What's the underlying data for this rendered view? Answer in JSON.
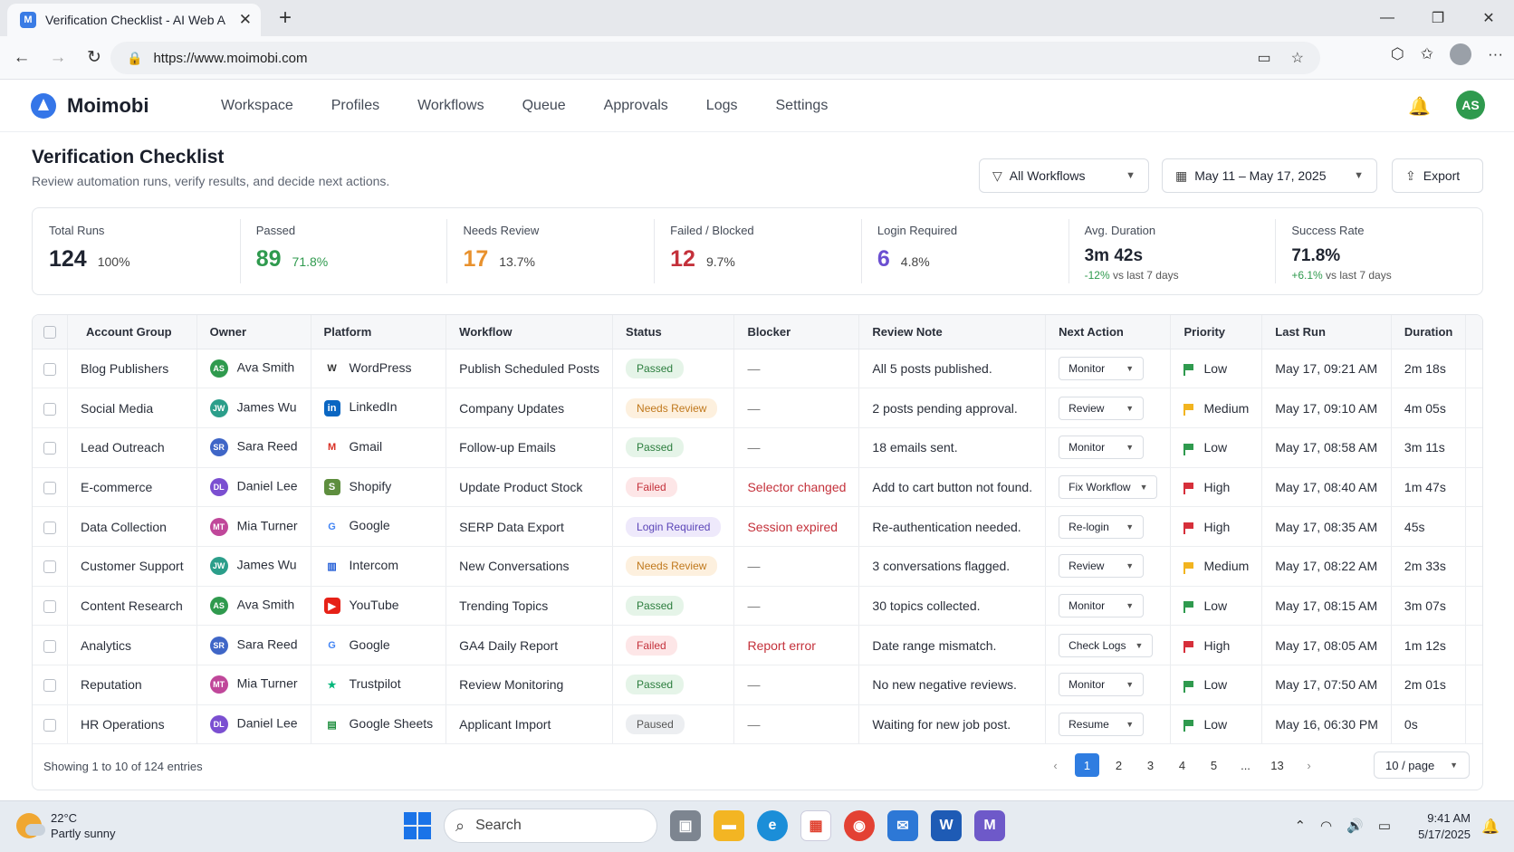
{
  "browser": {
    "tab_title": "Verification Checklist - AI Web A",
    "tab_favicon": "M",
    "url": "https://www.moimobi.com"
  },
  "app": {
    "name": "Moimobi",
    "nav": [
      "Workspace",
      "Profiles",
      "Workflows",
      "Queue",
      "Approvals",
      "Logs",
      "Settings"
    ],
    "user_initials": "AS"
  },
  "page": {
    "title": "Verification Checklist",
    "subtitle": "Review automation runs, verify results, and decide next actions.",
    "filter_workflow": "All Workflows",
    "date_range": "May 11 – May 17, 2025",
    "export_label": "Export"
  },
  "stats": {
    "total": {
      "label": "Total Runs",
      "value": "124",
      "pct": "100%"
    },
    "passed": {
      "label": "Passed",
      "value": "89",
      "pct": "71.8%"
    },
    "review": {
      "label": "Needs Review",
      "value": "17",
      "pct": "13.7%"
    },
    "failed": {
      "label": "Failed / Blocked",
      "value": "12",
      "pct": "9.7%"
    },
    "login": {
      "label": "Login Required",
      "value": "6",
      "pct": "4.8%"
    },
    "duration": {
      "label": "Avg. Duration",
      "value": "3m 42s",
      "trend": "-12%",
      "trend_text": "vs last 7 days"
    },
    "success": {
      "label": "Success Rate",
      "value": "71.8%",
      "trend": "+6.1%",
      "trend_text": "vs last 7 days"
    }
  },
  "table": {
    "columns": [
      "Account Group",
      "Owner",
      "Platform",
      "Workflow",
      "Status",
      "Blocker",
      "Review Note",
      "Next Action",
      "Priority",
      "Last Run",
      "Duration"
    ],
    "rows": [
      {
        "group": "Blog Publishers",
        "owner": "Ava Smith",
        "initials": "AS",
        "platform": "WordPress",
        "workflow": "Publish Scheduled Posts",
        "status": "Passed",
        "blocker": "—",
        "note": "All 5 posts published.",
        "action": "Monitor",
        "priority": "Low",
        "last_run": "May 17, 09:21 AM",
        "duration": "2m 18s"
      },
      {
        "group": "Social Media",
        "owner": "James Wu",
        "initials": "JW",
        "platform": "LinkedIn",
        "workflow": "Company Updates",
        "status": "Needs Review",
        "blocker": "—",
        "note": "2 posts pending approval.",
        "action": "Review",
        "priority": "Medium",
        "last_run": "May 17, 09:10 AM",
        "duration": "4m 05s"
      },
      {
        "group": "Lead Outreach",
        "owner": "Sara Reed",
        "initials": "SR",
        "platform": "Gmail",
        "workflow": "Follow-up Emails",
        "status": "Passed",
        "blocker": "—",
        "note": "18 emails sent.",
        "action": "Monitor",
        "priority": "Low",
        "last_run": "May 17, 08:58 AM",
        "duration": "3m 11s"
      },
      {
        "group": "E-commerce",
        "owner": "Daniel Lee",
        "initials": "DL",
        "platform": "Shopify",
        "workflow": "Update Product Stock",
        "status": "Failed",
        "blocker": "Selector changed",
        "note": "Add to cart button not found.",
        "action": "Fix Workflow",
        "priority": "High",
        "last_run": "May 17, 08:40 AM",
        "duration": "1m 47s"
      },
      {
        "group": "Data Collection",
        "owner": "Mia Turner",
        "initials": "MT",
        "platform": "Google",
        "workflow": "SERP Data Export",
        "status": "Login Required",
        "blocker": "Session expired",
        "note": "Re-authentication needed.",
        "action": "Re-login",
        "priority": "High",
        "last_run": "May 17, 08:35 AM",
        "duration": "45s"
      },
      {
        "group": "Customer Support",
        "owner": "James Wu",
        "initials": "JW",
        "platform": "Intercom",
        "workflow": "New Conversations",
        "status": "Needs Review",
        "blocker": "—",
        "note": "3 conversations flagged.",
        "action": "Review",
        "priority": "Medium",
        "last_run": "May 17, 08:22 AM",
        "duration": "2m 33s"
      },
      {
        "group": "Content Research",
        "owner": "Ava Smith",
        "initials": "AS",
        "platform": "YouTube",
        "workflow": "Trending Topics",
        "status": "Passed",
        "blocker": "—",
        "note": "30 topics collected.",
        "action": "Monitor",
        "priority": "Low",
        "last_run": "May 17, 08:15 AM",
        "duration": "3m 07s"
      },
      {
        "group": "Analytics",
        "owner": "Sara Reed",
        "initials": "SR",
        "platform": "Google",
        "workflow": "GA4 Daily Report",
        "status": "Failed",
        "blocker": "Report error",
        "note": "Date range mismatch.",
        "action": "Check Logs",
        "priority": "High",
        "last_run": "May 17, 08:05 AM",
        "duration": "1m 12s"
      },
      {
        "group": "Reputation",
        "owner": "Mia Turner",
        "initials": "MT",
        "platform": "Trustpilot",
        "workflow": "Review Monitoring",
        "status": "Passed",
        "blocker": "—",
        "note": "No new negative reviews.",
        "action": "Monitor",
        "priority": "Low",
        "last_run": "May 17, 07:50 AM",
        "duration": "2m 01s"
      },
      {
        "group": "HR Operations",
        "owner": "Daniel Lee",
        "initials": "DL",
        "platform": "Google Sheets",
        "workflow": "Applicant Import",
        "status": "Paused",
        "blocker": "—",
        "note": "Waiting for new job post.",
        "action": "Resume",
        "priority": "Low",
        "last_run": "May 16, 06:30 PM",
        "duration": "0s"
      }
    ]
  },
  "footer": {
    "showing": "Showing 1 to 10 of 124 entries",
    "pages": [
      "1",
      "2",
      "3",
      "4",
      "5",
      "...",
      "13"
    ],
    "per_page": "10 / page"
  },
  "taskbar": {
    "temp": "22°C",
    "weather": "Partly sunny",
    "search": "Search",
    "time": "9:41 AM",
    "date": "5/17/2025"
  },
  "colors": {
    "brand": "#3576e8",
    "passed": "#2f9a4e",
    "review": "#e8912d",
    "failed": "#c4313b",
    "login": "#6b4fd1"
  }
}
